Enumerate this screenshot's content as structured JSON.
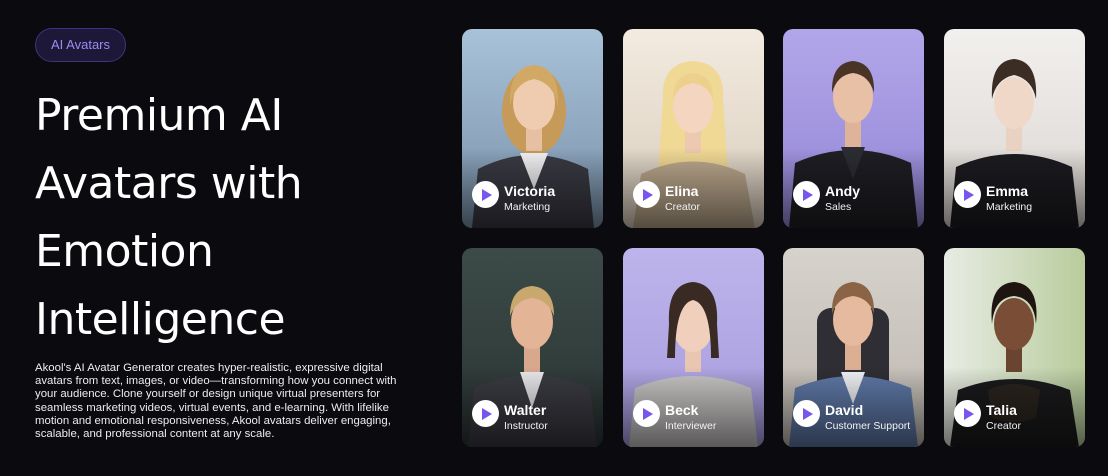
{
  "badge": "AI Avatars",
  "headline": [
    "Premium AI",
    "Avatars with",
    "Emotion",
    "Intelligence"
  ],
  "description": "Akool's AI Avatar Generator creates hyper-realistic, expressive digital avatars from text, images, or video—transforming how you connect with your audience. Clone yourself or design unique virtual presenters for seamless marketing videos, virtual events, and e-learning. With lifelike motion and emotional responsiveness, Akool avatars deliver engaging, scalable, and professional content at any scale.",
  "colors": {
    "background": "#0b0a0e",
    "badge_bg": "#1e1838",
    "badge_text": "#9a8cf0",
    "play_triangle": "#7755ee"
  },
  "avatars": [
    {
      "name": "Victoria",
      "role": "Marketing"
    },
    {
      "name": "Elina",
      "role": "Creator"
    },
    {
      "name": "Andy",
      "role": "Sales"
    },
    {
      "name": "Emma",
      "role": "Marketing"
    },
    {
      "name": "Walter",
      "role": "Instructor"
    },
    {
      "name": "Beck",
      "role": "Interviewer"
    },
    {
      "name": "David",
      "role": "Customer Support"
    },
    {
      "name": "Talia",
      "role": "Creator"
    }
  ]
}
